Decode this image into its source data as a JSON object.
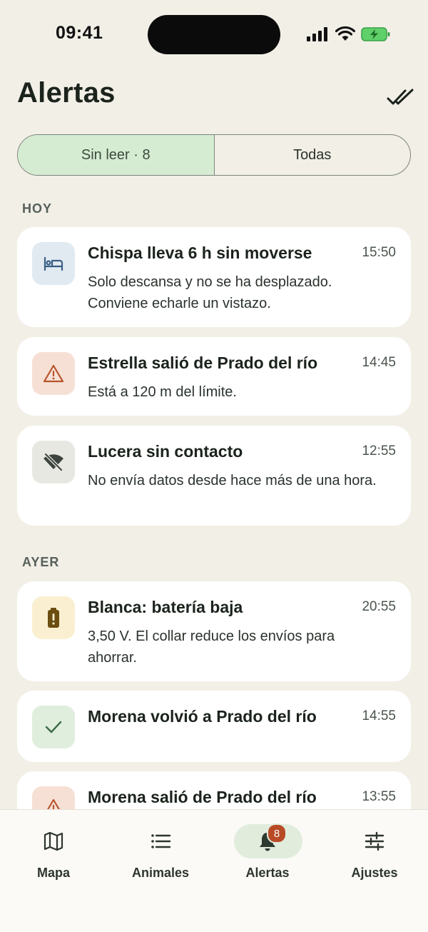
{
  "status_bar": {
    "time": "09:41"
  },
  "header": {
    "title": "Alertas"
  },
  "tabs": [
    {
      "label": "Sin leer · 8",
      "selected": true
    },
    {
      "label": "Todas",
      "selected": false
    }
  ],
  "sections": {
    "today": {
      "label": "HOY",
      "alerts": [
        {
          "icon": "bed-icon",
          "title": "Chispa lleva 6 h sin moverse",
          "time": "15:50",
          "body": "Solo descansa y no se ha desplazado. Conviene echarle un vistazo."
        },
        {
          "icon": "warning-icon",
          "title": "Estrella salió de Prado del río",
          "time": "14:45",
          "body": "Está a 120 m del límite."
        },
        {
          "icon": "signal-off-icon",
          "title": "Lucera sin contacto",
          "time": "12:55",
          "body": "No envía datos desde hace más de una hora."
        }
      ]
    },
    "yesterday": {
      "label": "AYER",
      "alerts": [
        {
          "icon": "battery-low-icon",
          "title": "Blanca: batería baja",
          "time": "20:55",
          "body": "3,50 V. El collar reduce los envíos para ahorrar."
        },
        {
          "icon": "check-icon",
          "title": "Morena volvió a Prado del río",
          "time": "14:55",
          "body": ""
        },
        {
          "icon": "warning-icon",
          "title": "Morena salió de Prado del río",
          "time": "13:55",
          "body": ""
        }
      ]
    }
  },
  "nav": {
    "items": [
      {
        "label": "Mapa",
        "icon": "map-icon"
      },
      {
        "label": "Animales",
        "icon": "list-icon"
      },
      {
        "label": "Alertas",
        "icon": "bell-icon",
        "active": true,
        "badge": "8"
      },
      {
        "label": "Ajustes",
        "icon": "sliders-icon"
      }
    ]
  },
  "colors": {
    "accent": "#d5ecd3",
    "badge": "#b84a26",
    "background": "#f2efe7"
  }
}
